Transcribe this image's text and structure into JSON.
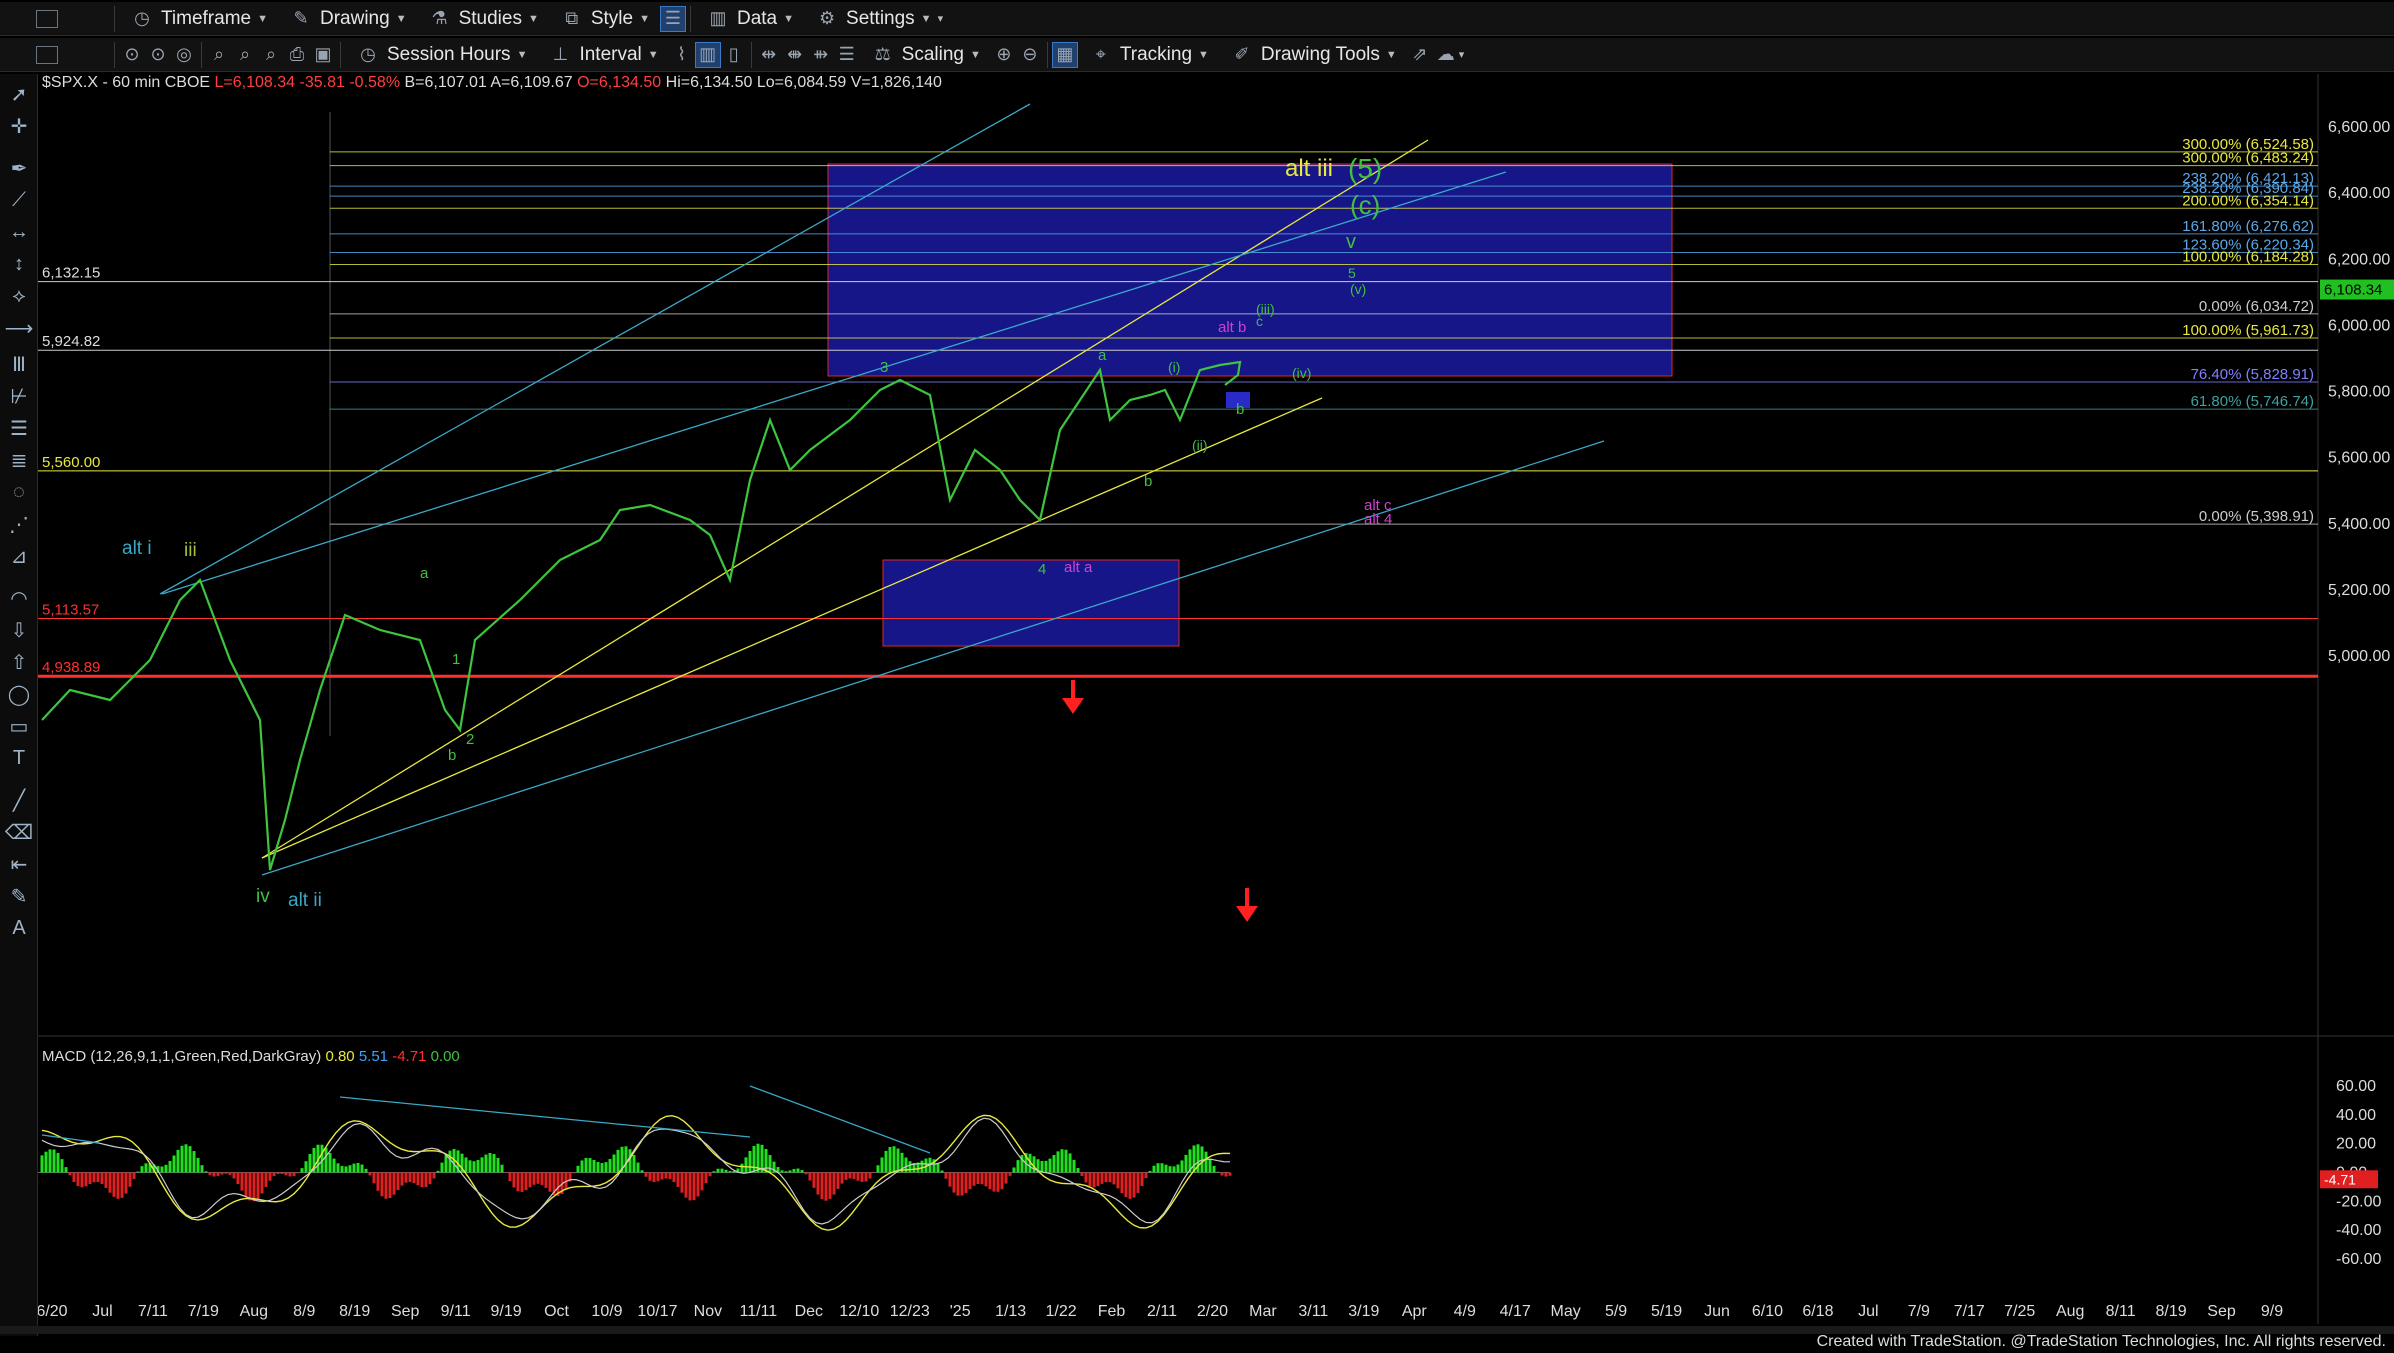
{
  "toolbar1": {
    "timeframe_label": "Timeframe",
    "drawing_label": "Drawing",
    "studies_label": "Studies",
    "style_label": "Style",
    "data_label": "Data",
    "settings_label": "Settings"
  },
  "toolbar2": {
    "session_hours_label": "Session Hours",
    "interval_label": "Interval",
    "scaling_label": "Scaling",
    "tracking_label": "Tracking",
    "drawing_tools_label": "Drawing Tools"
  },
  "symbol_header": {
    "symbol": "$SPX.X - 60 min",
    "exchange": "CBOE",
    "last": "L=6,108.34",
    "change": "-35.81",
    "change_pct": "-0.58%",
    "bid": "B=6,107.01",
    "ask": "A=6,109.67",
    "open": "O=6,134.50",
    "high": "Hi=6,134.50",
    "low": "Lo=6,084.59",
    "volume": "V=1,826,140"
  },
  "price_axis": {
    "labels": [
      "6,600.00",
      "6,400.00",
      "6,200.00",
      "6,000.00",
      "5,800.00",
      "5,600.00",
      "5,400.00",
      "5,200.00",
      "5,000.00"
    ],
    "current_price": "6,108.34"
  },
  "left_level_labels": [
    "6,132.15",
    "5,924.82",
    "5,560.00",
    "5,113.57",
    "4,938.89"
  ],
  "fib_labels": [
    {
      "text": "300.00% (6,524.58)",
      "color": "#e8e840"
    },
    {
      "text": "300.00% (6,483.24)",
      "color": "#e8e840"
    },
    {
      "text": "238.20% (6,421.13)",
      "color": "#5aa8e8"
    },
    {
      "text": "238.20% (6,390.84)",
      "color": "#5aa8e8"
    },
    {
      "text": "200.00% (6,354.14)",
      "color": "#e8e840"
    },
    {
      "text": "161.80% (6,276.62)",
      "color": "#5aa8e8"
    },
    {
      "text": "123.60% (6,220.34)",
      "color": "#5aa8e8"
    },
    {
      "text": "100.00% (6,184.28)",
      "color": "#e8e840"
    },
    {
      "text": "0.00% (6,034.72)",
      "color": "#cccccc"
    },
    {
      "text": "100.00% (5,961.73)",
      "color": "#e8e840"
    },
    {
      "text": "76.40% (5,828.91)",
      "color": "#8080ff"
    },
    {
      "text": "61.80% (5,746.74)",
      "color": "#40a0a0"
    },
    {
      "text": "0.00% (5,398.91)",
      "color": "#cccccc"
    }
  ],
  "wave_labels": {
    "alt_iii": "alt iii",
    "five": "(5)",
    "c": "(c)",
    "v": "v",
    "small_v": "(v)",
    "iii_paren": "(iii)",
    "iv_paren": "(iv)",
    "i_paren": "(i)",
    "ii_paren": "(ii)",
    "alt_b": "alt b",
    "alt_c": "alt c",
    "alt_4": "alt 4",
    "alt_a": "alt a",
    "alt_i": "alt i",
    "iii": "iii",
    "alt_ii": "alt ii",
    "iv": "iv",
    "a1": "a",
    "a2": "a",
    "b1": "b",
    "b2": "b",
    "b3": "b",
    "n1": "1",
    "n2": "2",
    "n3": "3",
    "n4": "4",
    "c_small": "c",
    "five_small": "5"
  },
  "macd": {
    "title": "MACD (12,26,9,1,1,Green,Red,DarkGray)",
    "v1": "0.80",
    "v2": "5.51",
    "v3": "-4.71",
    "v4": "0.00",
    "axis_labels": [
      "60.00",
      "40.00",
      "20.00",
      "0.00",
      "-20.00",
      "-40.00",
      "-60.00"
    ],
    "current": "-4.71"
  },
  "time_axis": [
    "6/20",
    "Jul",
    "7/11",
    "7/19",
    "Aug",
    "8/9",
    "8/19",
    "Sep",
    "9/11",
    "9/19",
    "Oct",
    "10/9",
    "10/17",
    "Nov",
    "11/11",
    "Dec",
    "12/10",
    "12/23",
    "'25",
    "1/13",
    "1/22",
    "Feb",
    "2/11",
    "2/20",
    "Mar",
    "3/11",
    "3/19",
    "Apr",
    "4/9",
    "4/17",
    "May",
    "5/9",
    "5/19",
    "Jun",
    "6/10",
    "6/18",
    "Jul",
    "7/9",
    "7/17",
    "7/25",
    "Aug",
    "8/11",
    "8/19",
    "Sep",
    "9/9"
  ],
  "footer": "Created with TradeStation. @TradeStation Technologies, Inc. All rights reserved.",
  "colors": {
    "background": "#000000",
    "toolbar": "#121212",
    "box_blue": "#1a1aa0",
    "fib_yellow": "#e8e840",
    "channel_cyan": "#3aa8c8",
    "wave_green": "#40c040",
    "wave_magenta": "#d040d0",
    "arrow_red": "#ff2020",
    "price_tag_green": "#20c020"
  }
}
